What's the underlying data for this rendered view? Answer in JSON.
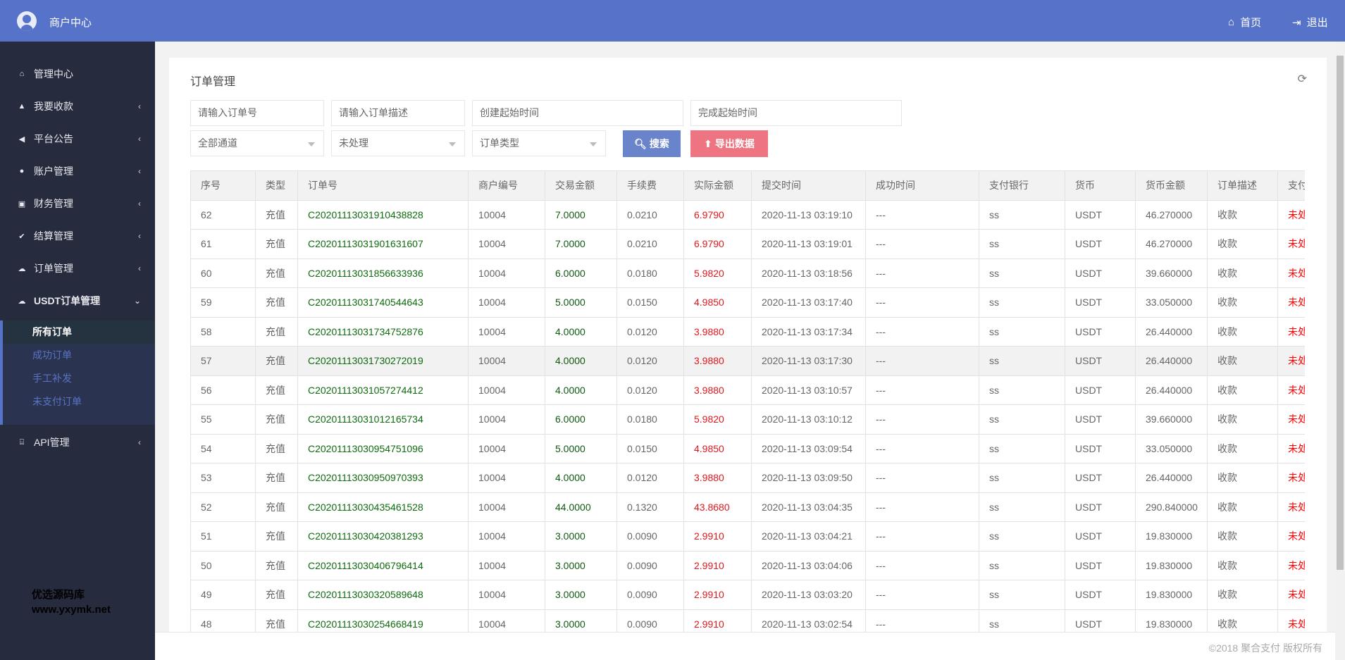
{
  "header": {
    "brand": "商户中心",
    "home": "首页",
    "logout": "退出",
    "color": "#5673c9"
  },
  "sidebar": {
    "items": [
      {
        "label": "管理中心",
        "icon": "home-icon"
      },
      {
        "label": "我要收款",
        "icon": "lock-icon",
        "arrow": "‹"
      },
      {
        "label": "平台公告",
        "icon": "volume-icon",
        "arrow": "‹"
      },
      {
        "label": "账户管理",
        "icon": "user-icon",
        "arrow": "‹"
      },
      {
        "label": "财务管理",
        "icon": "money-icon",
        "arrow": "‹"
      },
      {
        "label": "结算管理",
        "icon": "check-icon",
        "arrow": "‹"
      },
      {
        "label": "订单管理",
        "icon": "cloud-icon",
        "arrow": "‹"
      },
      {
        "label": "USDT订单管理",
        "icon": "cloud-icon",
        "arrow": "⌄"
      }
    ],
    "sub": [
      "所有订单",
      "成功订单",
      "手工补发",
      "未支付订单"
    ],
    "api": {
      "label": "API管理",
      "arrow": "‹"
    }
  },
  "watermark": {
    "line1": "优选源码库",
    "line2": "www.yxymk.net"
  },
  "main": {
    "title": "订单管理",
    "filters": {
      "order_no": "请输入订单号",
      "order_desc": "请输入订单描述",
      "create_time": "创建起始时间",
      "finish_time": "完成起始时间",
      "channel": "全部通道",
      "status": "未处理",
      "type": "订单类型"
    },
    "search": "搜索",
    "export": "导出数据",
    "search_color": "#6a84cc",
    "export_color": "#ee7482",
    "columns": [
      "序号",
      "类型",
      "订单号",
      "商户编号",
      "交易金额",
      "手续费",
      "实际金额",
      "提交时间",
      "成功时间",
      "支付银行",
      "货币",
      "货币金额",
      "订单描述",
      "支付状态"
    ],
    "rows": [
      [
        "62",
        "充值",
        "C20201113031910438828",
        "10004",
        "7.0000",
        "0.0210",
        "6.9790",
        "2020-11-13 03:19:10",
        "---",
        "ss",
        "USDT",
        "46.270000",
        "收款",
        "未处理"
      ],
      [
        "61",
        "充值",
        "C20201113031901631607",
        "10004",
        "7.0000",
        "0.0210",
        "6.9790",
        "2020-11-13 03:19:01",
        "---",
        "ss",
        "USDT",
        "46.270000",
        "收款",
        "未处理"
      ],
      [
        "60",
        "充值",
        "C20201113031856633936",
        "10004",
        "6.0000",
        "0.0180",
        "5.9820",
        "2020-11-13 03:18:56",
        "---",
        "ss",
        "USDT",
        "39.660000",
        "收款",
        "未处理"
      ],
      [
        "59",
        "充值",
        "C20201113031740544643",
        "10004",
        "5.0000",
        "0.0150",
        "4.9850",
        "2020-11-13 03:17:40",
        "---",
        "ss",
        "USDT",
        "33.050000",
        "收款",
        "未处理"
      ],
      [
        "58",
        "充值",
        "C20201113031734752876",
        "10004",
        "4.0000",
        "0.0120",
        "3.9880",
        "2020-11-13 03:17:34",
        "---",
        "ss",
        "USDT",
        "26.440000",
        "收款",
        "未处理"
      ],
      [
        "57",
        "充值",
        "C20201113031730272019",
        "10004",
        "4.0000",
        "0.0120",
        "3.9880",
        "2020-11-13 03:17:30",
        "---",
        "ss",
        "USDT",
        "26.440000",
        "收款",
        "未处理"
      ],
      [
        "56",
        "充值",
        "C20201113031057274412",
        "10004",
        "4.0000",
        "0.0120",
        "3.9880",
        "2020-11-13 03:10:57",
        "---",
        "ss",
        "USDT",
        "26.440000",
        "收款",
        "未处理"
      ],
      [
        "55",
        "充值",
        "C20201113031012165734",
        "10004",
        "6.0000",
        "0.0180",
        "5.9820",
        "2020-11-13 03:10:12",
        "---",
        "ss",
        "USDT",
        "39.660000",
        "收款",
        "未处理"
      ],
      [
        "54",
        "充值",
        "C20201113030954751096",
        "10004",
        "5.0000",
        "0.0150",
        "4.9850",
        "2020-11-13 03:09:54",
        "---",
        "ss",
        "USDT",
        "33.050000",
        "收款",
        "未处理"
      ],
      [
        "53",
        "充值",
        "C20201113030950970393",
        "10004",
        "4.0000",
        "0.0120",
        "3.9880",
        "2020-11-13 03:09:50",
        "---",
        "ss",
        "USDT",
        "26.440000",
        "收款",
        "未处理"
      ],
      [
        "52",
        "充值",
        "C20201113030435461528",
        "10004",
        "44.0000",
        "0.1320",
        "43.8680",
        "2020-11-13 03:04:35",
        "---",
        "ss",
        "USDT",
        "290.840000",
        "收款",
        "未处理"
      ],
      [
        "51",
        "充值",
        "C20201113030420381293",
        "10004",
        "3.0000",
        "0.0090",
        "2.9910",
        "2020-11-13 03:04:21",
        "---",
        "ss",
        "USDT",
        "19.830000",
        "收款",
        "未处理"
      ],
      [
        "50",
        "充值",
        "C20201113030406796414",
        "10004",
        "3.0000",
        "0.0090",
        "2.9910",
        "2020-11-13 03:04:06",
        "---",
        "ss",
        "USDT",
        "19.830000",
        "收款",
        "未处理"
      ],
      [
        "49",
        "充值",
        "C20201113030320589648",
        "10004",
        "3.0000",
        "0.0090",
        "2.9910",
        "2020-11-13 03:03:20",
        "---",
        "ss",
        "USDT",
        "19.830000",
        "收款",
        "未处理"
      ],
      [
        "48",
        "充值",
        "C20201113030254668419",
        "10004",
        "3.0000",
        "0.0090",
        "2.9910",
        "2020-11-13 03:02:54",
        "---",
        "ss",
        "USDT",
        "19.830000",
        "收款",
        "未处理"
      ]
    ]
  },
  "footer": {
    "copyright": "©2018 聚合支付 版权所有"
  }
}
